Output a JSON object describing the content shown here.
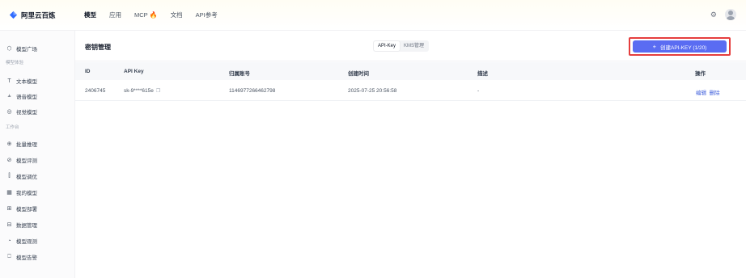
{
  "app": {
    "logo_text": "阿里云百炼"
  },
  "nav": [
    {
      "label": "模型",
      "active": true
    },
    {
      "label": "应用"
    },
    {
      "label": "MCP"
    },
    {
      "label": "文档"
    },
    {
      "label": "API参考"
    }
  ],
  "sidebar": {
    "items": [
      {
        "label": "模型广场",
        "icon": "cube-icon"
      },
      {
        "group": "模型体验"
      },
      {
        "label": "文本模型",
        "icon": "text-icon"
      },
      {
        "label": "语音模型",
        "icon": "voice-icon"
      },
      {
        "label": "视觉模型",
        "icon": "vision-icon"
      },
      {
        "group": "工作台"
      },
      {
        "label": "批量推理",
        "icon": "batch-icon"
      },
      {
        "label": "模型评测",
        "icon": "evaluate-icon"
      },
      {
        "label": "模型调优",
        "icon": "tune-icon"
      },
      {
        "label": "我的模型",
        "icon": "my-models-icon"
      },
      {
        "label": "模型部署",
        "icon": "deploy-icon"
      },
      {
        "label": "数据管理",
        "icon": "data-icon"
      },
      {
        "label": "模型观测",
        "icon": "observe-icon"
      },
      {
        "label": "模型告警",
        "icon": "alert-icon"
      }
    ]
  },
  "page": {
    "title": "密钥管理",
    "tabs": [
      {
        "label": "API-Key",
        "active": true
      },
      {
        "label": "KMS管理"
      }
    ],
    "create_button": "创建API-KEY (1/20)"
  },
  "table": {
    "columns": [
      "ID",
      "API Key",
      "归属账号",
      "创建时间",
      "描述",
      "操作"
    ],
    "rows": [
      {
        "id": "2406745",
        "api_key": "sk-9****615e",
        "account": "1146977266462798",
        "created": "2025-07-25 20:56:58",
        "description": "-",
        "actions": [
          "编辑",
          "删除"
        ]
      }
    ]
  },
  "colors": {
    "primary": "#5a6cf2",
    "highlight": "#e53e3e",
    "link": "#3b5bdb"
  }
}
